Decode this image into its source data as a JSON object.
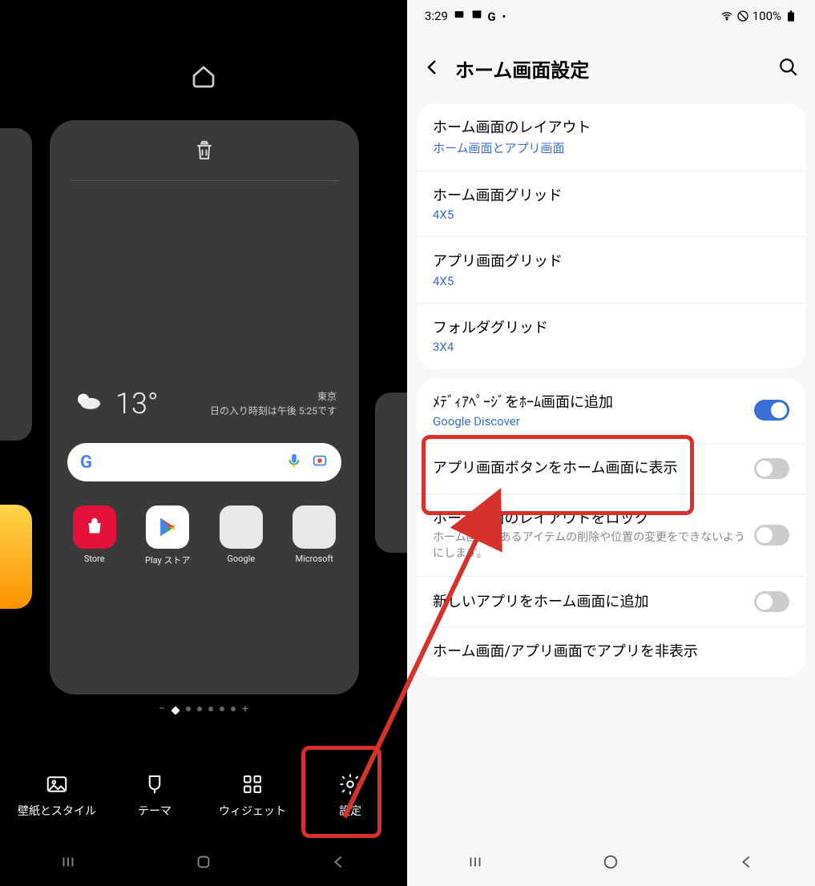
{
  "left": {
    "weather": {
      "temp": "13°",
      "city": "東京",
      "sunset": "日の入り時刻は午後 5:25です"
    },
    "apps": [
      {
        "label": "Store"
      },
      {
        "label": "Play ストア"
      },
      {
        "label": "Google"
      },
      {
        "label": "Microsoft"
      }
    ],
    "actions": {
      "wallpaper": "壁紙とスタイル",
      "themes": "テーマ",
      "widgets": "ウィジェット",
      "settings": "設定"
    }
  },
  "right": {
    "status": {
      "time": "3:29",
      "battery": "100%"
    },
    "title": "ホーム画面設定",
    "rows": {
      "layout": {
        "title": "ホーム画面のレイアウト",
        "sub": "ホーム画面とアプリ画面"
      },
      "homegrid": {
        "title": "ホーム画面グリッド",
        "sub": "4X5"
      },
      "appgrid": {
        "title": "アプリ画面グリッド",
        "sub": "4X5"
      },
      "foldergrid": {
        "title": "フォルダグリッド",
        "sub": "3X4"
      },
      "media": {
        "title": "ﾒﾃﾞｨｱﾍﾟｰｼﾞをﾎｰﾑ画面に追加",
        "sub": "Google Discover"
      },
      "appsbtn": {
        "title": "アプリ画面ボタンをホーム画面に表示"
      },
      "lock": {
        "title": "ホーム画面のレイアウトをロック",
        "desc": "ホーム画面にあるアイテムの削除や位置の変更をできないようにします。"
      },
      "newapp": {
        "title": "新しいアプリをホーム画面に追加"
      },
      "hide": {
        "title": "ホーム画面/アプリ画面でアプリを非表示"
      }
    }
  }
}
